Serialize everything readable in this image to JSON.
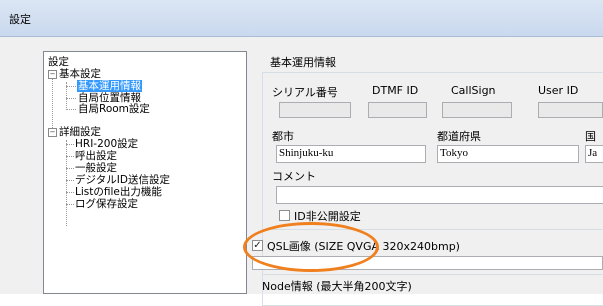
{
  "window": {
    "title": "設定"
  },
  "tree": {
    "root": "設定",
    "basic": "基本設定",
    "basic_items": [
      "基本運用情報",
      "自局位置情報",
      "自局Room設定"
    ],
    "detail": "詳細設定",
    "detail_items": [
      "HRI-200設定",
      "呼出設定",
      "一般設定",
      "デジタルID送信設定",
      "Listのfile出力機能",
      "ログ保存設定"
    ]
  },
  "pane": {
    "title": "基本運用情報",
    "headers": {
      "serial": "シリアル番号",
      "dtmf": "DTMF ID",
      "callsign": "CallSign",
      "userid": "User ID"
    },
    "city_label": "都市",
    "pref_label": "都道府県",
    "country_label": "国",
    "city_value": "Shinjuku-ku",
    "pref_value": "Tokyo",
    "country_value": "Ja",
    "comment_label": "コメント",
    "comment_value": "",
    "id_private_label": "ID非公開設定",
    "qsl_label": "QSL画像 (SIZE QVGA 320x240bmp)",
    "node_info_label": "Node情報 (最大半角200文字)"
  },
  "checks": {
    "id_private": "",
    "qsl": "✓"
  },
  "colors": {
    "highlight": "#3399ff",
    "annotation": "#f07f1e"
  }
}
